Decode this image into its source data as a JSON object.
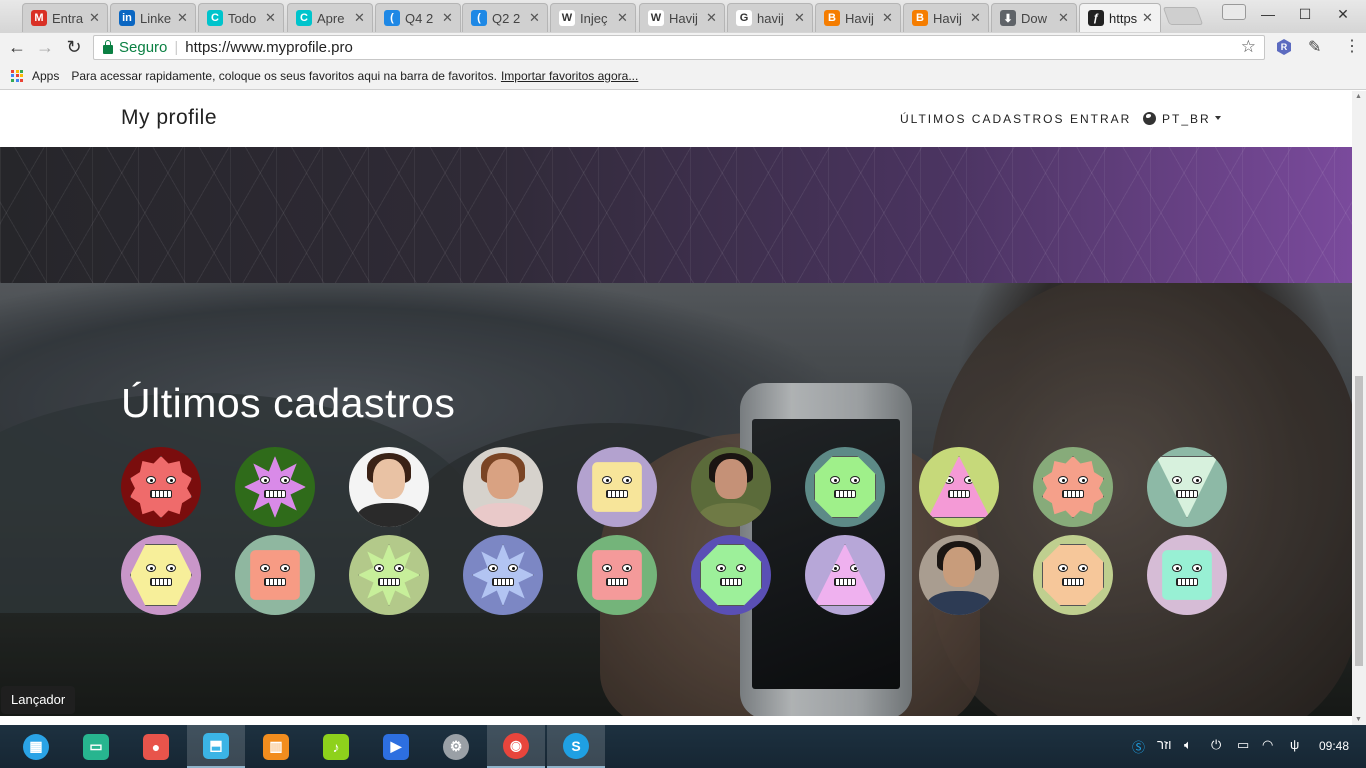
{
  "browser": {
    "tabs": [
      {
        "title": "Entra",
        "icon": "gmail-icon",
        "color": "#d93025",
        "glyph": "M"
      },
      {
        "title": "Linke",
        "icon": "linkedin-icon",
        "color": "#0a66c2",
        "glyph": "in"
      },
      {
        "title": "Todo",
        "icon": "canva-icon",
        "color": "#00c4cc",
        "glyph": "C"
      },
      {
        "title": "Apre",
        "icon": "canva-icon",
        "color": "#00c4cc",
        "glyph": "C"
      },
      {
        "title": "Q4 2",
        "icon": "crescent-icon",
        "color": "#1e88e5",
        "glyph": "("
      },
      {
        "title": "Q2 2",
        "icon": "crescent-icon",
        "color": "#1e88e5",
        "glyph": "("
      },
      {
        "title": "Injeç",
        "icon": "wikipedia-icon",
        "color": "#ffffff",
        "glyph": "W"
      },
      {
        "title": "Havij",
        "icon": "wikipedia-icon",
        "color": "#ffffff",
        "glyph": "W"
      },
      {
        "title": "havij",
        "icon": "google-icon",
        "color": "#ffffff",
        "glyph": "G"
      },
      {
        "title": "Havij",
        "icon": "blogger-icon",
        "color": "#f57d00",
        "glyph": "B"
      },
      {
        "title": "Havij",
        "icon": "blogger-icon",
        "color": "#f57d00",
        "glyph": "B"
      },
      {
        "title": "Dow",
        "icon": "download-icon",
        "color": "#5f6368",
        "glyph": "⬇"
      },
      {
        "title": "https",
        "icon": "symfony-icon",
        "color": "#222222",
        "glyph": "ƒ",
        "active": true
      }
    ],
    "security_label": "Seguro",
    "url": "https://www.myprofile.pro",
    "bookmarks": {
      "apps_label": "Apps",
      "hint": "Para acessar rapidamente, coloque os seus favoritos aqui na barra de favoritos.",
      "import_link": "Importar favoritos agora..."
    }
  },
  "site": {
    "brand": "My profile",
    "nav": {
      "latest": "ÚLTIMOS CADASTROS",
      "login": "ENTRAR",
      "language": "PT_BR"
    },
    "section_title": "Últimos cadastros"
  },
  "avatars": [
    {
      "kind": "robot",
      "bg": "#7a0d0d",
      "face": "#ef6b6b",
      "shape": "gear"
    },
    {
      "kind": "robot",
      "bg": "#2f6b1a",
      "face": "#d98ae8",
      "shape": "star"
    },
    {
      "kind": "photo",
      "bg": "#f4f4f4",
      "skin": "#e9c2a4",
      "hair": "#3a2216",
      "body": "#2a2a2a"
    },
    {
      "kind": "photo",
      "bg": "#d6d2cc",
      "skin": "#d9a282",
      "hair": "#7a4424",
      "body": "#e9c9c9"
    },
    {
      "kind": "robot",
      "bg": "#b3a2cf",
      "face": "#f7e59a",
      "shape": "square"
    },
    {
      "kind": "photo",
      "bg": "#5b6b3a",
      "skin": "#c59177",
      "hair": "#1a1412",
      "body": "#6f7a45"
    },
    {
      "kind": "robot",
      "bg": "#5d8a87",
      "face": "#9ff08a",
      "shape": "octagon"
    },
    {
      "kind": "robot",
      "bg": "#c6d97a",
      "face": "#f49ad6",
      "shape": "triangle"
    },
    {
      "kind": "robot",
      "bg": "#87ab7a",
      "face": "#f5a08a",
      "shape": "gear"
    },
    {
      "kind": "robot",
      "bg": "#8db9a6",
      "face": "#d7f1dd",
      "shape": "triangle-down"
    },
    {
      "kind": "robot",
      "bg": "#c996c9",
      "face": "#f7ef9a",
      "shape": "hexagon"
    },
    {
      "kind": "robot",
      "bg": "#8fb7a0",
      "face": "#f79b84",
      "shape": "square"
    },
    {
      "kind": "robot",
      "bg": "#b3c98a",
      "face": "#c7ef9a",
      "shape": "star"
    },
    {
      "kind": "robot",
      "bg": "#7c87c4",
      "face": "#b2c4f2",
      "shape": "star"
    },
    {
      "kind": "robot",
      "bg": "#74b47a",
      "face": "#f49a9a",
      "shape": "square"
    },
    {
      "kind": "robot",
      "bg": "#5a4fb5",
      "face": "#9df09a",
      "shape": "octagon"
    },
    {
      "kind": "robot",
      "bg": "#b7a7d8",
      "face": "#efb1ef",
      "shape": "triangle"
    },
    {
      "kind": "photo",
      "bg": "#a99d90",
      "skin": "#c89c7b",
      "hair": "#1b1613",
      "body": "#2d3b54"
    },
    {
      "kind": "robot",
      "bg": "#bfcf8f",
      "face": "#f6c79a",
      "shape": "octagon"
    },
    {
      "kind": "robot",
      "bg": "#d6bcd6",
      "face": "#98f0d4",
      "shape": "square"
    }
  ],
  "taskbar": {
    "tooltip": "Lançador",
    "apps": [
      {
        "name": "launcher-icon",
        "color": "#2aa3e6",
        "glyph": "▦"
      },
      {
        "name": "terminal-icon",
        "color": "#27b58f",
        "glyph": "▭"
      },
      {
        "name": "screen-recorder-icon",
        "color": "#e8544b",
        "glyph": "●"
      },
      {
        "name": "app-store-icon",
        "color": "#3bb4e6",
        "glyph": "⬒",
        "active": true
      },
      {
        "name": "files-icon",
        "color": "#f28d1e",
        "glyph": "▥"
      },
      {
        "name": "music-icon",
        "color": "#8ed11c",
        "glyph": "♪"
      },
      {
        "name": "video-icon",
        "color": "#2d6fe0",
        "glyph": "▶"
      },
      {
        "name": "settings-icon",
        "color": "#9aa0a6",
        "glyph": "⚙"
      },
      {
        "name": "chrome-icon",
        "color": "#e8453c",
        "glyph": "◉",
        "active": true
      },
      {
        "name": "skype-icon",
        "color": "#1fa0e3",
        "glyph": "S",
        "active": true
      }
    ],
    "clock": "09:48",
    "tray_text": "וזר"
  }
}
